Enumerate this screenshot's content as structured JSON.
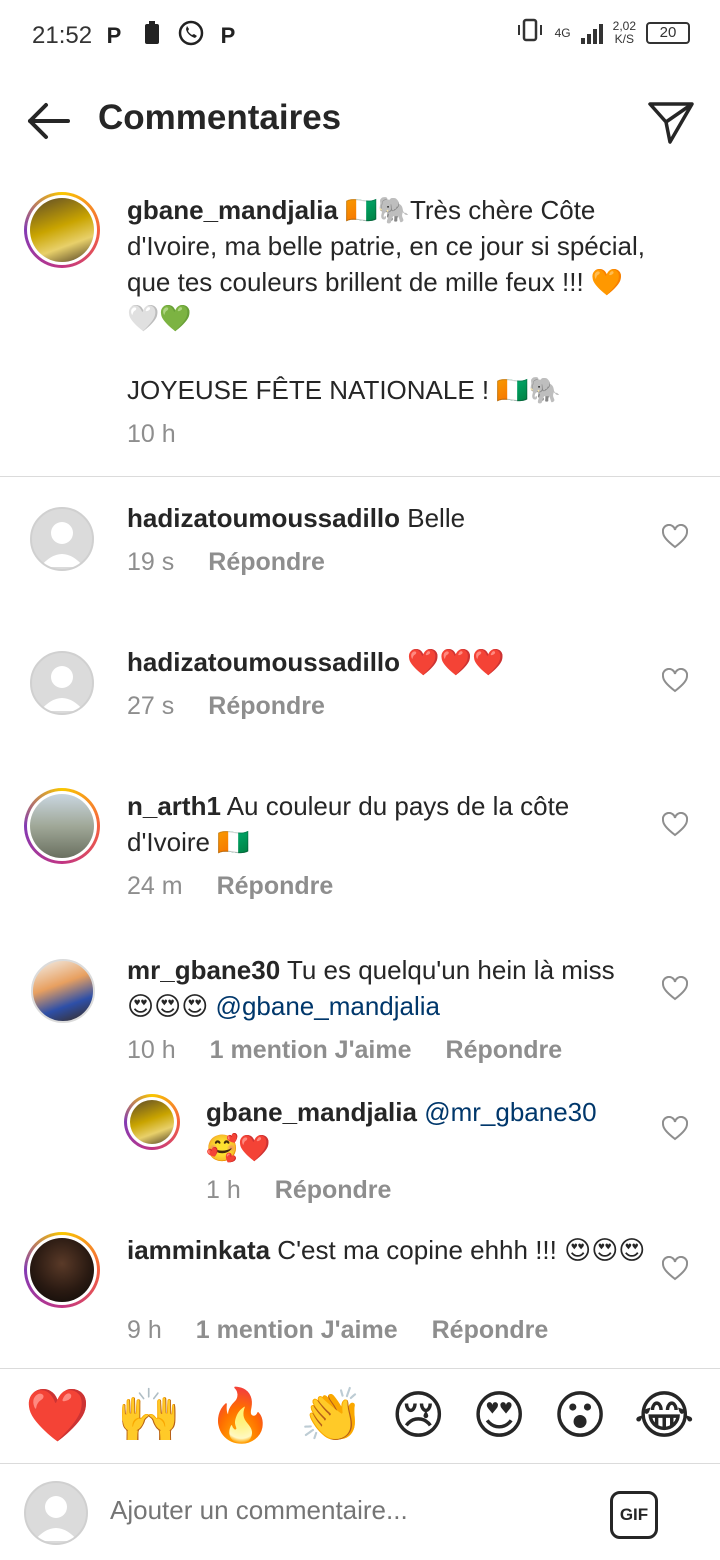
{
  "status": {
    "time": "21:52",
    "left_icons": [
      "P",
      "battery-saver",
      "whatsapp",
      "P"
    ],
    "network": "4G",
    "speed_value": "2,02",
    "speed_unit": "K/S",
    "battery": "20"
  },
  "header": {
    "title": "Commentaires",
    "back_icon": "arrow-left-icon",
    "send_icon": "paper-plane-icon"
  },
  "caption": {
    "username": "gbane_mandjalia",
    "text": " 🇨🇮🐘Très chère Côte d'Ivoire, ma belle patrie, en ce jour si spécial, que tes couleurs brillent de mille feux !!! 🧡🤍💚",
    "text2": "JOYEUSE FÊTE NATIONALE ! 🇨🇮🐘",
    "time": "10 h"
  },
  "comments": [
    {
      "username": "hadizatoumoussadillo",
      "text": " Belle",
      "time": "19 s",
      "reply": "Répondre"
    },
    {
      "username": "hadizatoumoussadillo",
      "text": " ❤️❤️❤️",
      "time": "27 s",
      "reply": "Répondre"
    },
    {
      "username": "n_arth1",
      "text": " Au couleur du pays de la côte d'Ivoire 🇨🇮",
      "time": "24 m",
      "reply": "Répondre"
    },
    {
      "username": "mr_gbane30",
      "text": " Tu es quelqu'un hein là miss 😍😍😍 ",
      "mention": "@gbane_mandjalia",
      "time": "10 h",
      "likes": "1 mention J'aime",
      "reply": "Répondre"
    },
    {
      "username": "gbane_mandjalia",
      "text": " ",
      "mention": "@mr_gbane30",
      "text2": "🥰❤️",
      "time": "1 h",
      "reply": "Répondre"
    },
    {
      "username": "iamminkata",
      "text": " C'est ma copine ehhh !!! 😍😍😍",
      "time": "9 h",
      "likes": "1 mention J'aime",
      "reply": "Répondre"
    }
  ],
  "emoji_bar": [
    "❤️",
    "🙌",
    "🔥",
    "👏",
    "😢",
    "😍",
    "😮",
    "😂"
  ],
  "input": {
    "placeholder": "Ajouter un commentaire...",
    "gif": "GIF"
  }
}
